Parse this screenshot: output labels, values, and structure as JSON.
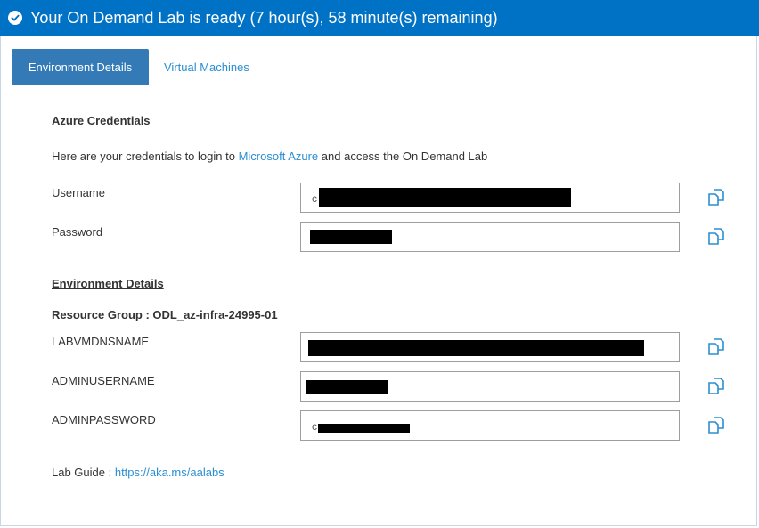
{
  "banner": {
    "text": "Your On Demand Lab is ready (7 hour(s), 58 minute(s) remaining)",
    "icon": "check-circle-icon",
    "color": "#0072c6"
  },
  "tabs": [
    {
      "label": "Environment Details",
      "active": true
    },
    {
      "label": "Virtual Machines",
      "active": false
    }
  ],
  "credentials": {
    "title": "Azure Credentials",
    "intro_prefix": "Here are your credentials to login to",
    "intro_link": "Microsoft Azure",
    "intro_suffix": "and access the On Demand Lab",
    "fields": [
      {
        "label": "Username",
        "value": "c"
      },
      {
        "label": "Password",
        "value": ""
      }
    ]
  },
  "environment": {
    "title": "Environment Details",
    "resource_group": "Resource Group : ODL_az-infra-24995-01",
    "fields": [
      {
        "label": "LABVMDNSNAME",
        "value": ""
      },
      {
        "label": "ADMINUSERNAME",
        "value": ""
      },
      {
        "label": "ADMINPASSWORD",
        "value": "c"
      }
    ]
  },
  "lab_guide": {
    "label": "Lab Guide :",
    "link": "https://aka.ms/aalabs"
  },
  "colors": {
    "accent": "#337ab7",
    "link": "#2a8fd1",
    "copy_icon": "#2a8fd1"
  }
}
